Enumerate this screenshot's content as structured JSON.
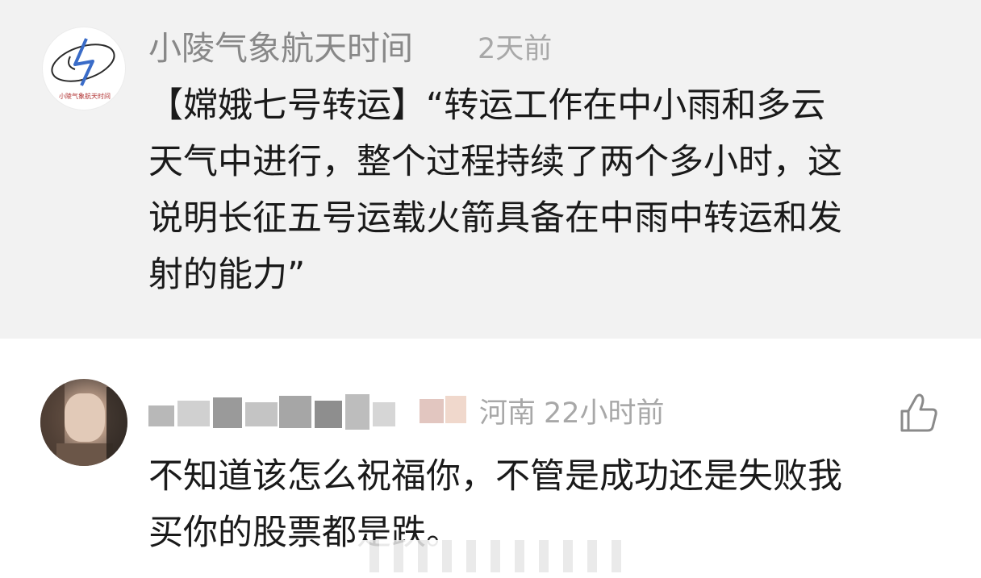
{
  "post": {
    "author": "小陵气象航天时间",
    "time": "2天前",
    "avatar_icon": "logo-icon",
    "avatar_caption": "小陵气象航天时间",
    "text": "【嫦娥七号转运】“转运工作在中小雨和多云\n天气中进行，整个过程持续了两个多小时，这\n说明长征五号运载火箭具备在中雨中转运和发\n射的能力”"
  },
  "reply": {
    "location": "河南",
    "time": "22小时前",
    "like_icon": "thumbs-up-icon",
    "text": "不知道该怎么祝福你，不管是成功还是失败我\n买你的股票都是跌。"
  },
  "colors": {
    "quoted_bg": "#f2f2f2",
    "meta_gray": "#a8a8a8",
    "author_gray": "#888888",
    "text": "#1a1a1a"
  }
}
